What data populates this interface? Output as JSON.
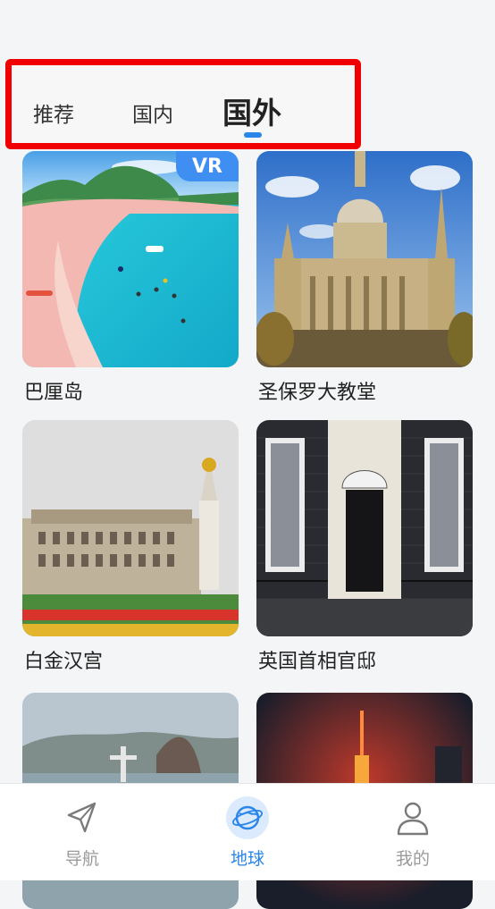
{
  "tabs": [
    {
      "label": "推荐",
      "active": false
    },
    {
      "label": "国内",
      "active": false
    },
    {
      "label": "国外",
      "active": true
    }
  ],
  "cards": [
    {
      "title": "巴厘岛",
      "badge": "VR"
    },
    {
      "title": "圣保罗大教堂"
    },
    {
      "title": "白金汉宫"
    },
    {
      "title": "英国首相官邸"
    },
    {
      "title": ""
    },
    {
      "title": ""
    }
  ],
  "bottom_nav": [
    {
      "label": "导航",
      "icon": "navigation-arrow-icon",
      "active": false
    },
    {
      "label": "地球",
      "icon": "globe-icon",
      "active": true
    },
    {
      "label": "我的",
      "icon": "user-profile-icon",
      "active": false
    }
  ],
  "colors": {
    "accent": "#2a86e8",
    "highlight_border": "#f00000",
    "badge": "#3f8ff2"
  }
}
